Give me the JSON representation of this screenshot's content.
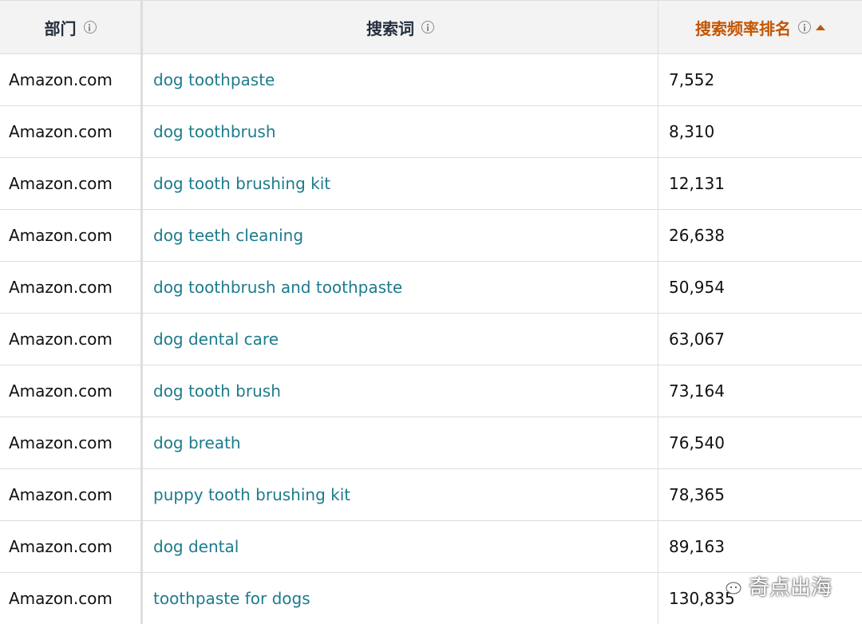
{
  "table": {
    "headers": {
      "department": "部门",
      "search_term": "搜索词",
      "search_frequency_rank": "搜索频率排名"
    },
    "rows": [
      {
        "department": "Amazon.com",
        "search_term": "dog toothpaste",
        "rank": "7,552"
      },
      {
        "department": "Amazon.com",
        "search_term": "dog toothbrush",
        "rank": "8,310"
      },
      {
        "department": "Amazon.com",
        "search_term": "dog tooth brushing kit",
        "rank": "12,131"
      },
      {
        "department": "Amazon.com",
        "search_term": "dog teeth cleaning",
        "rank": "26,638"
      },
      {
        "department": "Amazon.com",
        "search_term": "dog toothbrush and toothpaste",
        "rank": "50,954"
      },
      {
        "department": "Amazon.com",
        "search_term": "dog dental care",
        "rank": "63,067"
      },
      {
        "department": "Amazon.com",
        "search_term": "dog tooth brush",
        "rank": "73,164"
      },
      {
        "department": "Amazon.com",
        "search_term": "dog breath",
        "rank": "76,540"
      },
      {
        "department": "Amazon.com",
        "search_term": "puppy tooth brushing kit",
        "rank": "78,365"
      },
      {
        "department": "Amazon.com",
        "search_term": "dog dental",
        "rank": "89,163"
      },
      {
        "department": "Amazon.com",
        "search_term": "toothpaste for dogs",
        "rank": "130,835"
      }
    ]
  },
  "watermark": {
    "text": "奇点出海",
    "icon": "wechat-icon"
  },
  "colors": {
    "link": "#1d7b8c",
    "active_sort_header": "#c45500",
    "header_background": "#f3f3f3"
  }
}
